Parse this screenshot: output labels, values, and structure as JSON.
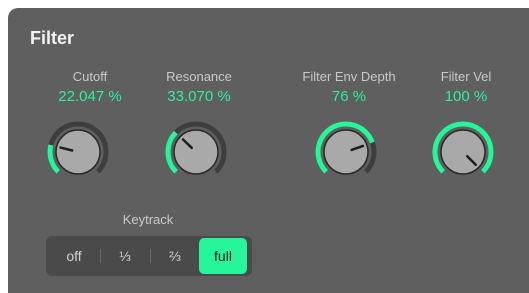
{
  "panel": {
    "title": "Filter"
  },
  "knobs": [
    {
      "name": "Cutoff",
      "value": "22.047 %",
      "fraction": 0.22
    },
    {
      "name": "Resonance",
      "value": "33.070 %",
      "fraction": 0.33
    },
    {
      "name": "Filter Env Depth",
      "value": "76 %",
      "fraction": 0.76
    },
    {
      "name": "Filter Vel",
      "value": "100 %",
      "fraction": 1.0
    }
  ],
  "keytrack": {
    "label": "Keytrack",
    "options": [
      "off",
      "⅓",
      "⅔",
      "full"
    ],
    "selected": "full"
  },
  "colors": {
    "accent": "#27f59a",
    "track": "#3e3e3e",
    "panel": "#5f5f5f"
  }
}
